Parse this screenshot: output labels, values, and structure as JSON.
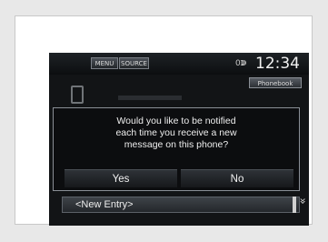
{
  "topbar": {
    "menu_label": "MENU",
    "source_label": "SOURCE",
    "signal_text": "0ↇ",
    "clock": "12:34"
  },
  "phonebook_label": "Phonebook",
  "dialog": {
    "message": "Would you like to be notified\neach time you receive a new\nmessage on this phone?",
    "yes_label": "Yes",
    "no_label": "No"
  },
  "list": {
    "entry_label": "<New Entry>"
  },
  "icons": {
    "scroll_down": "»"
  }
}
